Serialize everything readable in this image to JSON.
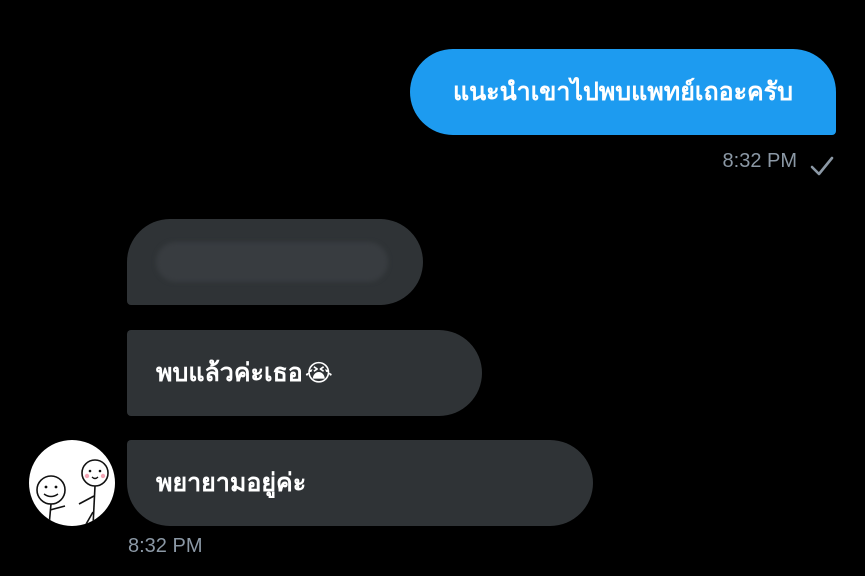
{
  "conversation": {
    "outgoing": {
      "text": "แนะนำเขาไปพบแพทย์เถอะครับ",
      "time": "8:32 PM",
      "status_icon": "check-icon"
    },
    "incoming": {
      "messages": [
        {
          "text": "",
          "redacted": true
        },
        {
          "text": "พบแล้วค่ะเธอ",
          "emoji": "😭",
          "emoji_name": "loudly-crying-face-emoji"
        },
        {
          "text": "พยายามอยู่ค่ะ"
        }
      ],
      "time": "8:32 PM",
      "avatar_icon": "stick-figure-avatar-icon"
    }
  },
  "colors": {
    "background": "#000000",
    "outgoing_bubble": "#1d9bf0",
    "incoming_bubble": "#2f3336",
    "meta_text": "#8b98a5"
  }
}
